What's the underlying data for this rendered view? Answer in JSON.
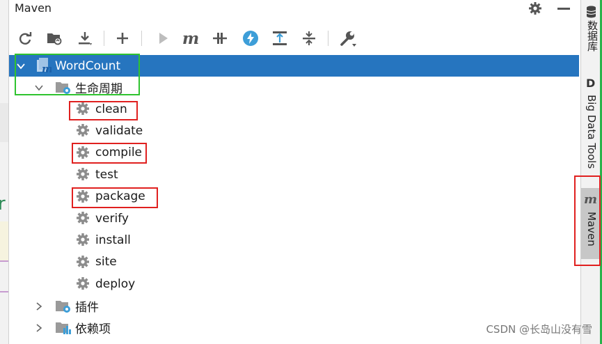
{
  "panel": {
    "title": "Maven"
  },
  "toolbar": {
    "buttons": [
      "reload-all-icon",
      "generate-sources-icon",
      "download-sources-icon",
      "add-maven-project-icon",
      "run-icon",
      "execute-goal-icon",
      "toggle-offline-icon",
      "skip-tests-icon",
      "show-dependencies-icon",
      "collapse-all-icon",
      "settings-wrench-icon"
    ]
  },
  "tree": {
    "root": {
      "label": "WordCount",
      "icon": "maven-module-icon"
    },
    "lifecycle": {
      "label": "生命周期",
      "icon": "lifecycle-folder-icon"
    },
    "goals": [
      "clean",
      "validate",
      "compile",
      "test",
      "package",
      "verify",
      "install",
      "site",
      "deploy"
    ],
    "plugins": {
      "label": "插件",
      "icon": "plugins-folder-icon"
    },
    "dependencies": {
      "label": "依赖项",
      "icon": "dependencies-folder-icon"
    }
  },
  "right_tool_windows": [
    {
      "label": "数据库",
      "icon": "database-icon"
    },
    {
      "label": "Big Data Tools",
      "icon": "big-data-tools-icon"
    },
    {
      "label": "Maven",
      "icon": "maven-m-icon",
      "active": true
    }
  ],
  "watermark": "CSDN @长岛山没有雪",
  "colors": {
    "selection": "#2675bf",
    "highlight_red": "#e0201f",
    "highlight_green": "#2fc32f",
    "active_tab": "#c7c7c7",
    "edge_green": "#27b34a"
  }
}
